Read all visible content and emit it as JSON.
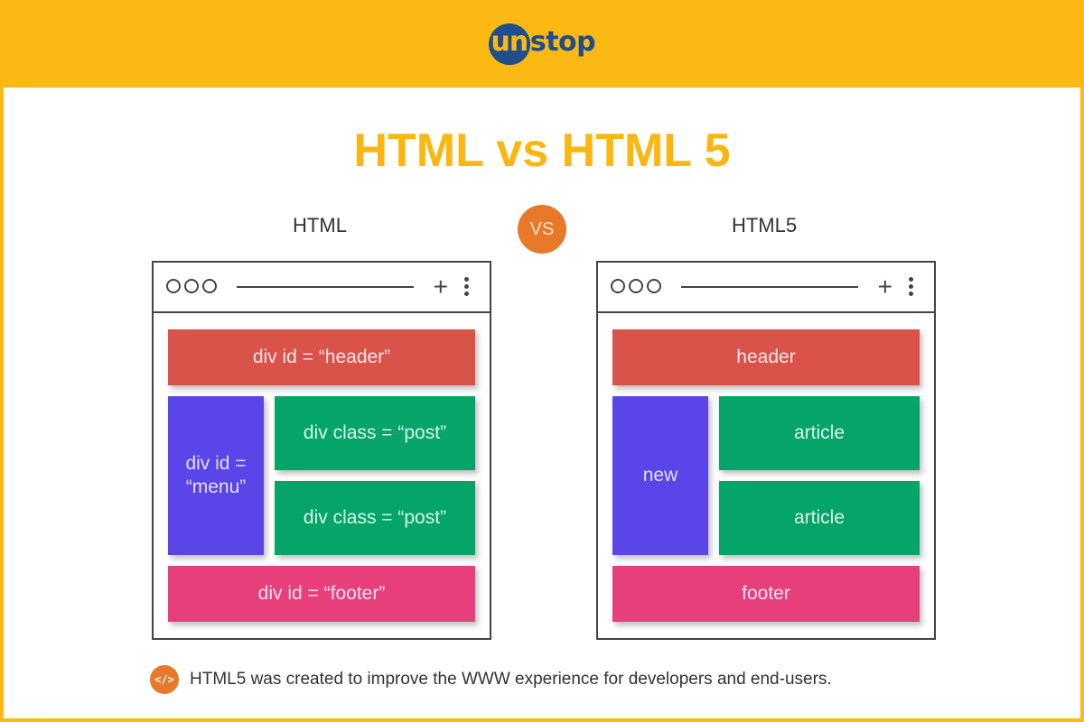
{
  "brand": {
    "logo_part1": "un",
    "logo_part2": "stop"
  },
  "title": "HTML vs HTML 5",
  "vs_label": "VS",
  "colors": {
    "brand_yellow": "#fdb913",
    "brand_blue": "#1f4e8c",
    "title": "#fbb60f",
    "vs_orange": "#e8782a",
    "header_red": "#d9534a",
    "menu_purple": "#5945e8",
    "post_green": "#05a468",
    "footer_pink": "#e63f7c"
  },
  "left": {
    "label": "HTML",
    "header": "div id = “header”",
    "menu_line1": "div id =",
    "menu_line2": "“menu”",
    "post1": "div class = “post”",
    "post2": "div class = “post”",
    "footer": "div id = “footer”"
  },
  "right": {
    "label": "HTML5",
    "header": "header",
    "menu": "new",
    "post1": "article",
    "post2": "article",
    "footer": "footer"
  },
  "browser_chrome": {
    "plus": "+",
    "icons": [
      "window-dots-icon",
      "address-bar-line",
      "plus-icon",
      "kebab-menu-icon"
    ]
  },
  "note": {
    "icon": "</>",
    "text": "HTML5 was created to improve the WWW experience for developers and end-users."
  }
}
